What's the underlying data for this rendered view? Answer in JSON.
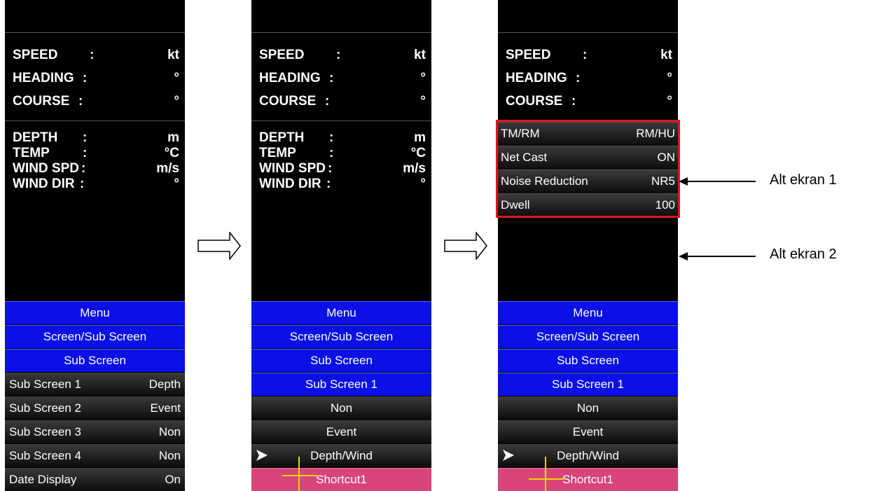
{
  "info": {
    "nav": [
      {
        "key": "SPEED",
        "colon": ":",
        "unit": "kt"
      },
      {
        "key": "HEADING",
        "colon": ":",
        "unit": "°"
      },
      {
        "key": "COURSE",
        "colon": ":",
        "unit": "°"
      }
    ],
    "env": [
      {
        "key": "DEPTH",
        "colon": ":",
        "unit": "m"
      },
      {
        "key": "TEMP",
        "colon": ":",
        "unit": "°C"
      },
      {
        "key": "WIND SPD",
        "colon": ":",
        "unit": "m/s"
      },
      {
        "key": "WIND DIR",
        "colon": ":",
        "unit": "°"
      }
    ]
  },
  "panel1": {
    "menu": "Menu",
    "screen_sub": "Screen/Sub Screen",
    "sub_screen": "Sub Screen",
    "rows": [
      {
        "label": "Sub Screen 1",
        "value": "Depth"
      },
      {
        "label": "Sub Screen 2",
        "value": "Event"
      },
      {
        "label": "Sub Screen 3",
        "value": "Non"
      },
      {
        "label": "Sub Screen 4",
        "value": "Non"
      },
      {
        "label": "Date Display",
        "value": "On"
      }
    ]
  },
  "panel2": {
    "menu": "Menu",
    "screen_sub": "Screen/Sub Screen",
    "sub_screen": "Sub Screen",
    "sub_screen_1": "Sub Screen 1",
    "options": [
      "Non",
      "Event",
      "Depth/Wind"
    ],
    "shortcut": "Shortcut1"
  },
  "panel3": {
    "sub1_rows": [
      {
        "label": "TM/RM",
        "value": "RM/HU"
      },
      {
        "label": "Net Cast",
        "value": "ON"
      },
      {
        "label": "Noise Reduction",
        "value": "NR5"
      },
      {
        "label": "Dwell",
        "value": "100"
      }
    ],
    "menu": "Menu",
    "screen_sub": "Screen/Sub Screen",
    "sub_screen": "Sub Screen",
    "sub_screen_1": "Sub Screen 1",
    "options": [
      "Non",
      "Event",
      "Depth/Wind"
    ],
    "shortcut": "Shortcut1"
  },
  "annotations": {
    "alt1": "Alt ekran 1",
    "alt2": "Alt ekran 2"
  },
  "colors": {
    "menu_blue": "#0a10e6",
    "shortcut_pink": "#d9447a",
    "cursor_yellow": "#e8d800",
    "highlight_red": "#e0141e"
  },
  "icons": [
    "arrow-right-outline-icon",
    "chevron-right-icon",
    "crosshair-cursor-icon",
    "arrow-left-icon"
  ]
}
